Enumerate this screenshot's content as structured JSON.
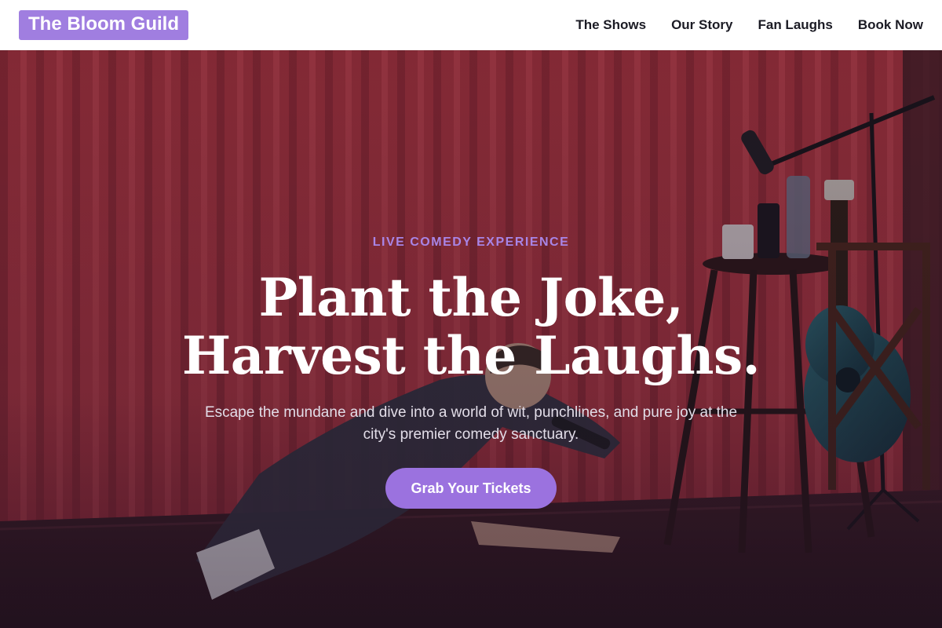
{
  "header": {
    "brand": "The Bloom Guild",
    "nav": [
      "The Shows",
      "Our Story",
      "Fan Laughs",
      "Book Now"
    ]
  },
  "hero": {
    "eyebrow": "LIVE COMEDY EXPERIENCE",
    "headline_line1": "Plant the Joke,",
    "headline_line2": "Harvest the Laughs.",
    "subtext": "Escape the mundane and dive into a world of wit, punchlines, and pure joy at the city's premier comedy sanctuary.",
    "cta_label": "Grab Your Tickets"
  },
  "colors": {
    "brand_bg": "#a07ee0",
    "accent": "#9b72df",
    "eyebrow": "#a885e6",
    "curtain": "#b8323d"
  }
}
